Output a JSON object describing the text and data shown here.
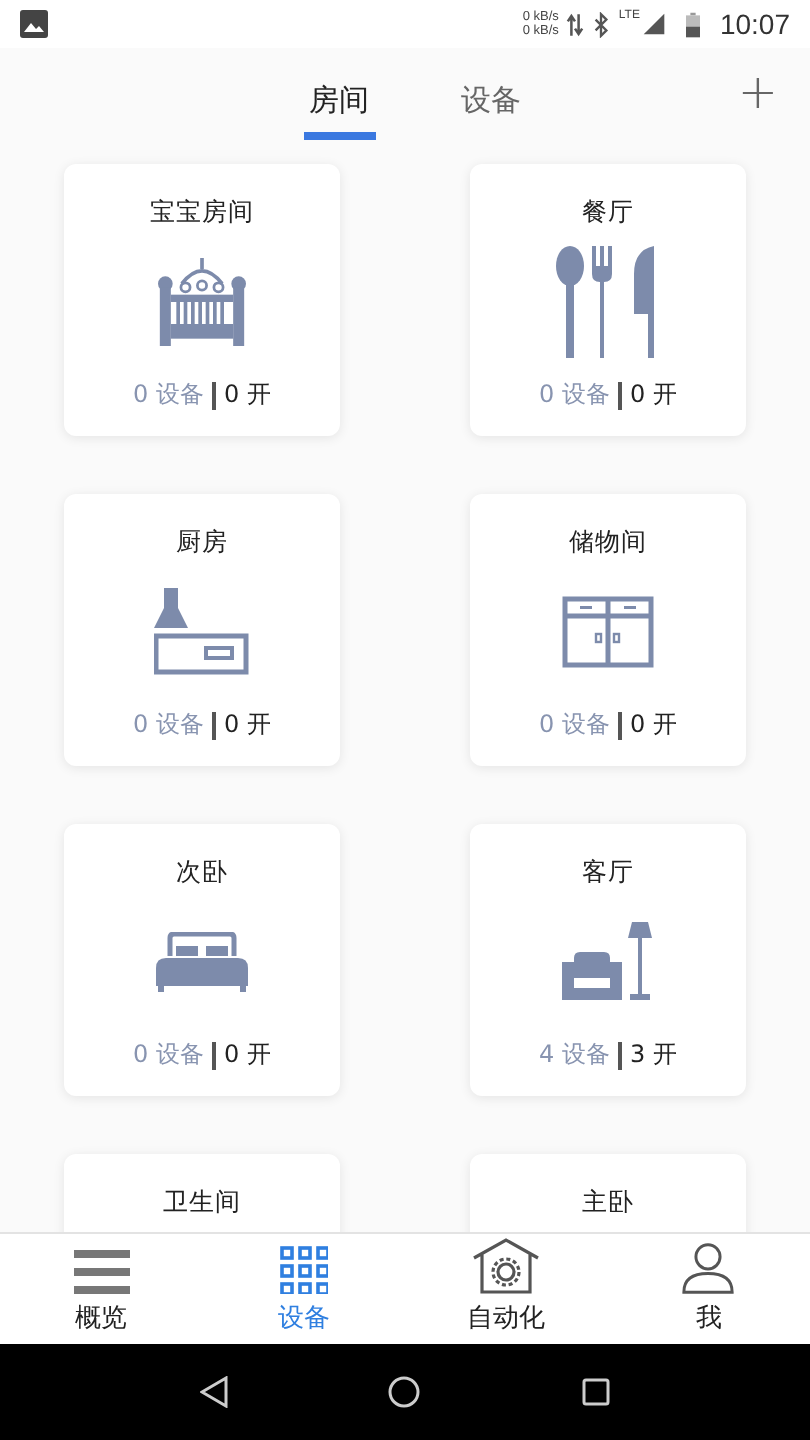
{
  "status_bar": {
    "speed_up": "0 kB/s",
    "speed_down": "0 kB/s",
    "network": "LTE",
    "time": "10:07"
  },
  "tabs": [
    {
      "label": "房间",
      "selected": true
    },
    {
      "label": "设备",
      "selected": false
    }
  ],
  "add_button": {
    "label": "+"
  },
  "rooms": [
    {
      "name": "宝宝房间",
      "kind": "crib",
      "devices": "0 设备",
      "on": "0 开"
    },
    {
      "name": "餐厅",
      "kind": "cutlery",
      "devices": "0 设备",
      "on": "0 开"
    },
    {
      "name": "厨房",
      "kind": "kitchen",
      "devices": "0 设备",
      "on": "0 开"
    },
    {
      "name": "储物间",
      "kind": "cabinet",
      "devices": "0 设备",
      "on": "0 开"
    },
    {
      "name": "次卧",
      "kind": "bed",
      "devices": "0 设备",
      "on": "0 开"
    },
    {
      "name": "客厅",
      "kind": "sofa",
      "devices": "4 设备",
      "on": "3 开"
    },
    {
      "name": "卫生间"
    },
    {
      "name": "主卧"
    }
  ],
  "bottom_nav": [
    {
      "label": "概览",
      "kind": "overview",
      "selected": false
    },
    {
      "label": "设备",
      "kind": "devices",
      "selected": true
    },
    {
      "label": "自动化",
      "kind": "automation",
      "selected": false
    },
    {
      "label": "我",
      "kind": "profile",
      "selected": false
    }
  ]
}
